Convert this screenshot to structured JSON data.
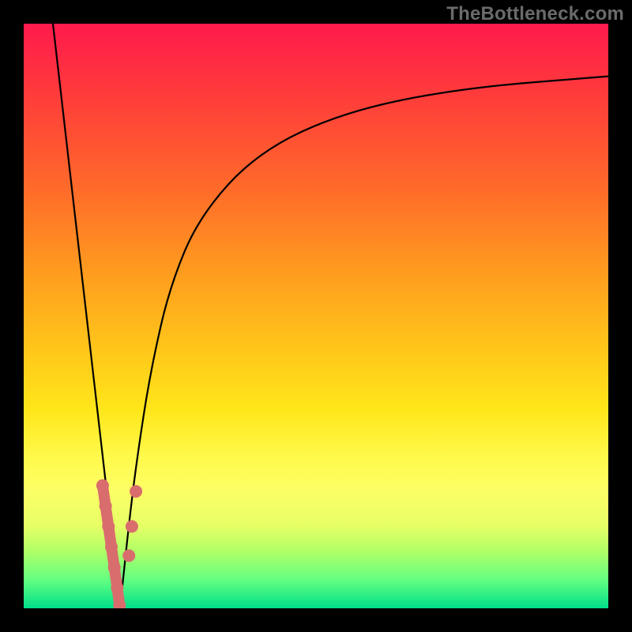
{
  "watermark": "TheBottleneck.com",
  "colors": {
    "bg_black": "#000000",
    "curve_black": "#000000",
    "marker_pink": "#d96d6d",
    "gradient_stops": [
      "#ff1a4d",
      "#ff3b3b",
      "#ff6a2a",
      "#ff9a1f",
      "#ffc41a",
      "#ffe61a",
      "#fff94a",
      "#fcff66",
      "#e6ff66",
      "#b3ff66",
      "#66ff80",
      "#00e08a"
    ]
  },
  "chart_data": {
    "type": "line",
    "title": "",
    "xlabel": "",
    "ylabel": "",
    "xlim": [
      0,
      100
    ],
    "ylim": [
      0,
      100
    ],
    "grid": false,
    "legend": false,
    "description": "Two-branch V-shaped curve: steep left line descending from top to a minimum, then a saturating/logarithmic rise toward the top-right. A pink marker path sits near the minimum.",
    "series": [
      {
        "name": "left-branch",
        "type": "line",
        "x": [
          5,
          16.5
        ],
        "y": [
          100,
          0
        ]
      },
      {
        "name": "right-branch",
        "type": "curve",
        "x": [
          16.5,
          18,
          20,
          22,
          25,
          30,
          40,
          55,
          75,
          100
        ],
        "y": [
          0,
          15,
          30,
          42,
          55,
          67,
          78,
          85,
          89,
          91
        ]
      },
      {
        "name": "pink-marker-left",
        "type": "line_with_markers",
        "x": [
          13.5,
          14.0,
          14.5,
          15.0,
          15.5,
          16.0,
          16.4
        ],
        "y": [
          21,
          17.5,
          14,
          10.5,
          7,
          3.5,
          0.5
        ]
      },
      {
        "name": "pink-marker-right-dots",
        "type": "markers",
        "x": [
          18.0,
          18.5,
          19.2
        ],
        "y": [
          9,
          14,
          20
        ]
      }
    ]
  }
}
